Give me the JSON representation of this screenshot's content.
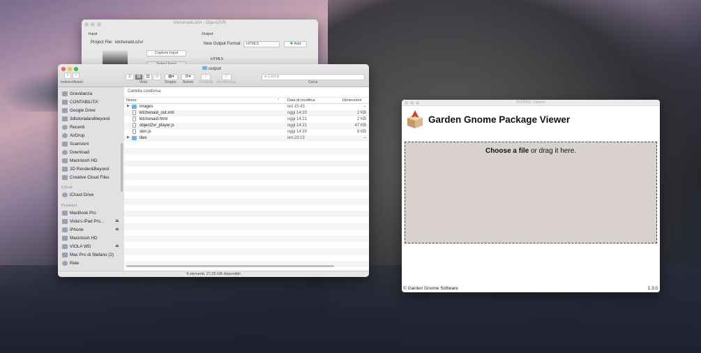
{
  "object2vr": {
    "title": "kitchenaid.o2vr - Object2VR",
    "input_label": "Input",
    "project_file_label": "Project File:",
    "project_file": "kitchenaid.o2vr",
    "capture_input": "Capture Input",
    "select_input": "Select Input",
    "output_label": "Output",
    "new_output_format_label": "New Output Format:",
    "format_value": "HTML5",
    "add_button": "Add",
    "output_item": "HTML5"
  },
  "finder": {
    "folder_title": "output",
    "back_forward_label": "Indietro/Avanti",
    "toolbar_captions": {
      "vista": "Vista",
      "gruppo": "Gruppo",
      "azione": "Azione",
      "condividi": "Condividi",
      "modifica_tag": "Modifica tag",
      "cerca": "Cerca"
    },
    "search_placeholder": "Cerca",
    "sidebar": {
      "favorites": [
        "Gravidanza",
        "CONTABILITA'",
        "Google Drive",
        "3dtutorialandbeyond",
        "Recenti",
        "AirDrop",
        "Scansioni",
        "Download",
        "Macintosh HD",
        "3D Render&Beyond",
        "Creative Cloud Files"
      ],
      "icloud_header": "iCloud",
      "icloud": [
        "iCloud Drive"
      ],
      "locations_header": "Posizioni",
      "locations": [
        "MacBook Pro",
        "Viola's iPad Pro...",
        "iPhone",
        "Macintosh HD",
        "VIOLA WD",
        "Mac Pro di Stefano (2)",
        "Rete"
      ]
    },
    "path_header": "Cartella condivisa",
    "columns": {
      "name": "Nome",
      "date": "Data di modifica",
      "size": "Dimensioni"
    },
    "files": [
      {
        "name": "images",
        "date": "ieri 15:43",
        "size": "--",
        "kind": "folder"
      },
      {
        "name": "kitchenaid_out.xml",
        "date": "oggi 14:20",
        "size": "2 KB",
        "kind": "file"
      },
      {
        "name": "kitchenaid.html",
        "date": "oggi 14:21",
        "size": "2 KB",
        "kind": "file"
      },
      {
        "name": "object2vr_player.js",
        "date": "oggi 14:21",
        "size": "47 KB",
        "kind": "file"
      },
      {
        "name": "skin.js",
        "date": "oggi 14:20",
        "size": "8 KB",
        "kind": "file"
      },
      {
        "name": "tiles",
        "date": "ieri 23:13",
        "size": "--",
        "kind": "folder"
      }
    ],
    "status": "6 elementi, 27,25 GB disponibili"
  },
  "ggpkg": {
    "window_title": "GGPKG Viewer",
    "heading": "Garden Gnome Package Viewer",
    "drop_link": "Choose a file",
    "drop_rest": " or drag it here.",
    "footer": "© Garden Gnome Software",
    "version": "1.3.0"
  },
  "colors": {
    "folder": "#6ab5e8",
    "drop_bg": "#d8d1cd",
    "add_icon": "#3cb043"
  }
}
